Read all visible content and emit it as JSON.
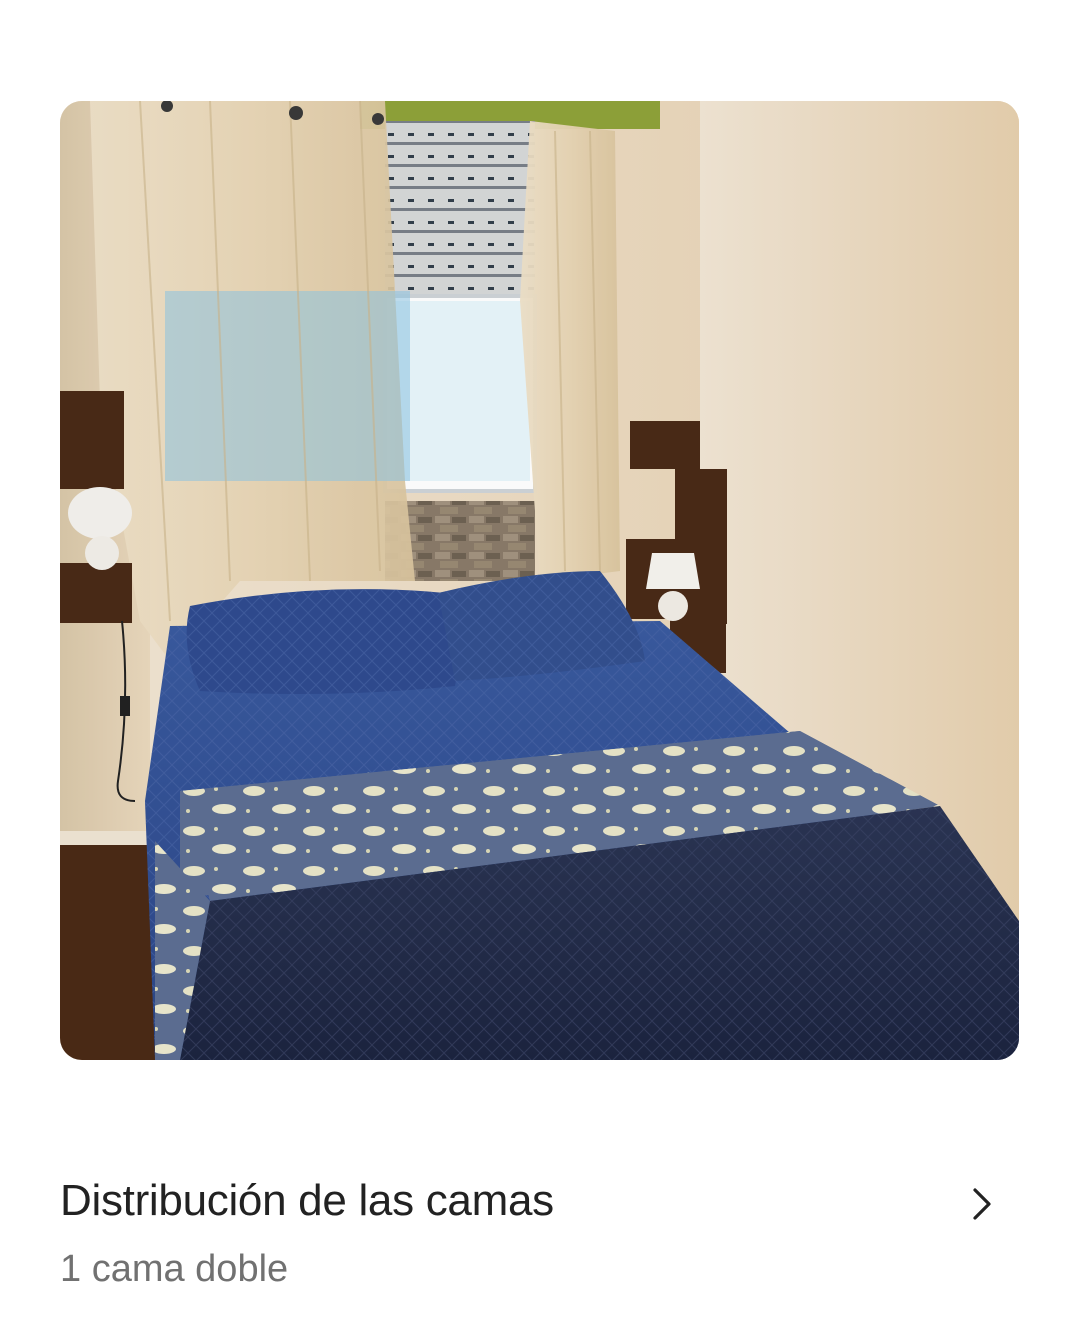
{
  "photo": {
    "subject": "bedroom-photo"
  },
  "bed_arrangement": {
    "title": "Distribución de las camas",
    "subtitle": "1 cama doble"
  },
  "icons": {
    "chevron": "chevron-right-icon"
  },
  "colors": {
    "title": "#222222",
    "subtitle": "#717171",
    "background": "#ffffff"
  }
}
